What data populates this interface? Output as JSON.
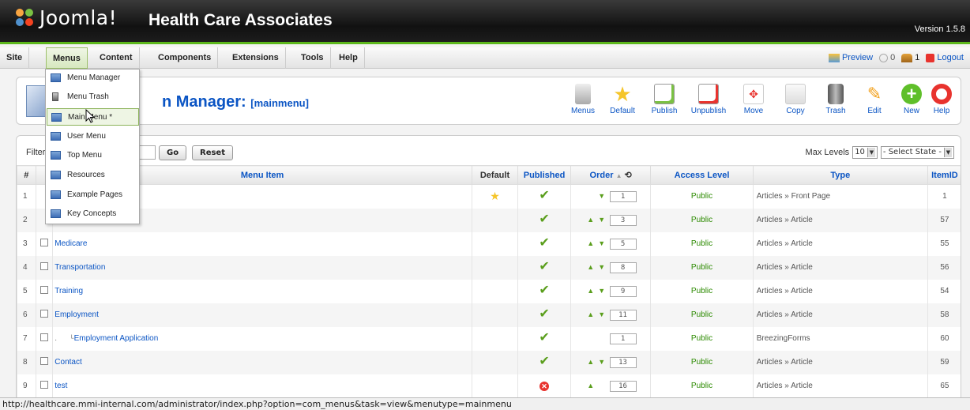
{
  "header": {
    "logo_text": "Joomla!",
    "site_name": "Health Care Associates",
    "version": "Version 1.5.8"
  },
  "menubar": {
    "items": [
      "Site",
      "Menus",
      "Content",
      "Components",
      "Extensions",
      "Tools",
      "Help"
    ],
    "active": "Menus",
    "preview": "Preview",
    "messages_count": "0",
    "users_count": "1",
    "logout": "Logout"
  },
  "dropdown": {
    "items": [
      "Menu Manager",
      "Menu Trash",
      "Main Menu *",
      "User Menu",
      "Top Menu",
      "Resources",
      "Example Pages",
      "Key Concepts"
    ],
    "hovered": "Main Menu *"
  },
  "toolbar": {
    "title": "n Manager:",
    "subtitle": "[mainmenu]",
    "buttons": [
      "Menus",
      "Default",
      "Publish",
      "Unpublish",
      "Move",
      "Copy",
      "Trash",
      "Edit",
      "New",
      "Help"
    ]
  },
  "filter": {
    "label": "Filter:",
    "go": "Go",
    "reset": "Reset",
    "max_levels_label": "Max Levels",
    "max_levels_value": "10",
    "state_select": "- Select State -"
  },
  "table": {
    "headers": {
      "num": "#",
      "item": "Menu Item",
      "default": "Default",
      "published": "Published",
      "order": "Order",
      "access": "Access Level",
      "type": "Type",
      "itemid": "ItemID"
    },
    "rows": [
      {
        "num": "1",
        "name": "",
        "default": true,
        "published": true,
        "up": false,
        "down": true,
        "order": "1",
        "access": "Public",
        "type": "Articles » Front Page",
        "itemid": "1"
      },
      {
        "num": "2",
        "name": "",
        "default": false,
        "published": true,
        "up": true,
        "down": true,
        "order": "3",
        "access": "Public",
        "type": "Articles » Article",
        "itemid": "57"
      },
      {
        "num": "3",
        "name": "Medicare",
        "default": false,
        "published": true,
        "up": true,
        "down": true,
        "order": "5",
        "access": "Public",
        "type": "Articles » Article",
        "itemid": "55"
      },
      {
        "num": "4",
        "name": "Transportation",
        "default": false,
        "published": true,
        "up": true,
        "down": true,
        "order": "8",
        "access": "Public",
        "type": "Articles » Article",
        "itemid": "56"
      },
      {
        "num": "5",
        "name": "Training",
        "default": false,
        "published": true,
        "up": true,
        "down": true,
        "order": "9",
        "access": "Public",
        "type": "Articles » Article",
        "itemid": "54"
      },
      {
        "num": "6",
        "name": "Employment",
        "default": false,
        "published": true,
        "up": true,
        "down": true,
        "order": "11",
        "access": "Public",
        "type": "Articles » Article",
        "itemid": "58"
      },
      {
        "num": "7",
        "name": "Employment Application",
        "child": true,
        "default": false,
        "published": true,
        "up": false,
        "down": false,
        "order": "1",
        "access": "Public",
        "type": "BreezingForms",
        "itemid": "60"
      },
      {
        "num": "8",
        "name": "Contact",
        "default": false,
        "published": true,
        "up": true,
        "down": true,
        "order": "13",
        "access": "Public",
        "type": "Articles » Article",
        "itemid": "59"
      },
      {
        "num": "9",
        "name": "test",
        "default": false,
        "published": false,
        "up": true,
        "down": false,
        "order": "16",
        "access": "Public",
        "type": "Articles » Article",
        "itemid": "65"
      }
    ]
  },
  "statusbar": {
    "url": "http://healthcare.mmi-internal.com/administrator/index.php?option=com_menus&task=view&menutype=mainmenu"
  }
}
